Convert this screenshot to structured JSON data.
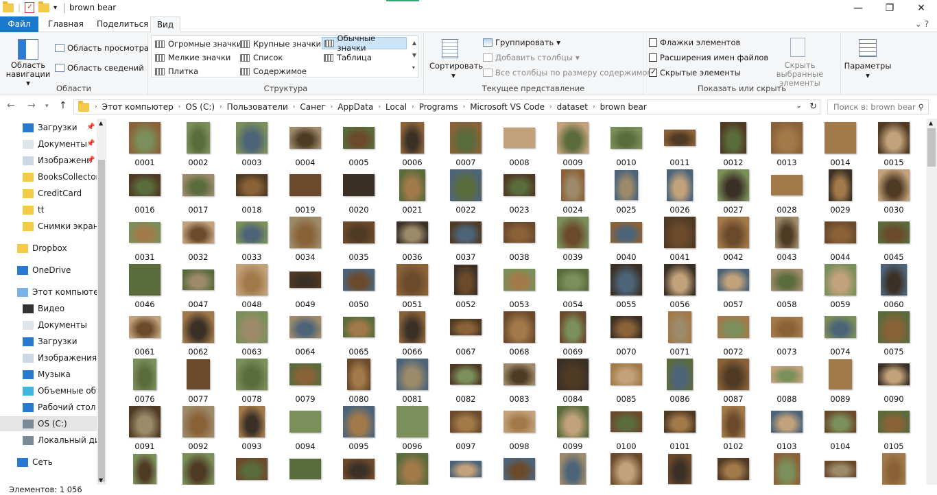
{
  "window": {
    "title": "brown bear",
    "minimize": "—",
    "maximize": "❐",
    "close": "✕"
  },
  "tabs": {
    "file": "Файл",
    "home": "Главная",
    "share": "Поделиться",
    "view": "Вид",
    "help": "⌄ ?"
  },
  "ribbon": {
    "panes": {
      "label": "Области",
      "nav_pane": "Область навигации",
      "preview_pane": "Область просмотра",
      "details_pane": "Область сведений"
    },
    "layout": {
      "label": "Структура",
      "items": [
        "Огромные значки",
        "Крупные значки",
        "Обычные значки",
        "Мелкие значки",
        "Список",
        "Таблица",
        "Плитка",
        "Содержимое"
      ]
    },
    "current_view": {
      "label": "Текущее представление",
      "sort": "Сортировать",
      "group": "Группировать",
      "add_columns": "Добавить столбцы",
      "fit_columns": "Все столбцы по размеру содержимого"
    },
    "show_hide": {
      "label": "Показать или скрыть",
      "item_checkboxes": "Флажки элементов",
      "file_extensions": "Расширения имен файлов",
      "hidden_items": "Скрытые элементы",
      "hide_selected": "Скрыть выбранные элементы",
      "item_checkboxes_checked": false,
      "file_extensions_checked": false,
      "hidden_items_checked": true
    },
    "options": {
      "label": "Параметры"
    }
  },
  "address": {
    "crumbs": [
      "Этот компьютер",
      "OS (C:)",
      "Пользователи",
      "Санег",
      "AppData",
      "Local",
      "Programs",
      "Microsoft VS Code",
      "dataset",
      "brown bear"
    ],
    "search_placeholder": "Поиск в: brown bear"
  },
  "sidebar": {
    "quick": [
      "Загрузки",
      "Документы",
      "Изображени",
      "BooksCollector",
      "CreditCard",
      "tt",
      "Снимки экрана"
    ],
    "dropbox": "Dropbox",
    "onedrive": "OneDrive",
    "this_pc": "Этот компьютер",
    "pc_items": [
      "Видео",
      "Документы",
      "Загрузки",
      "Изображения",
      "Музыка",
      "Объемные объ",
      "Рабочий стол",
      "OS (C:)",
      "Локальный дис"
    ],
    "network": "Сеть"
  },
  "files": {
    "count_visible": 120,
    "first": 1
  },
  "status": {
    "text": "Элементов: 1 056"
  }
}
